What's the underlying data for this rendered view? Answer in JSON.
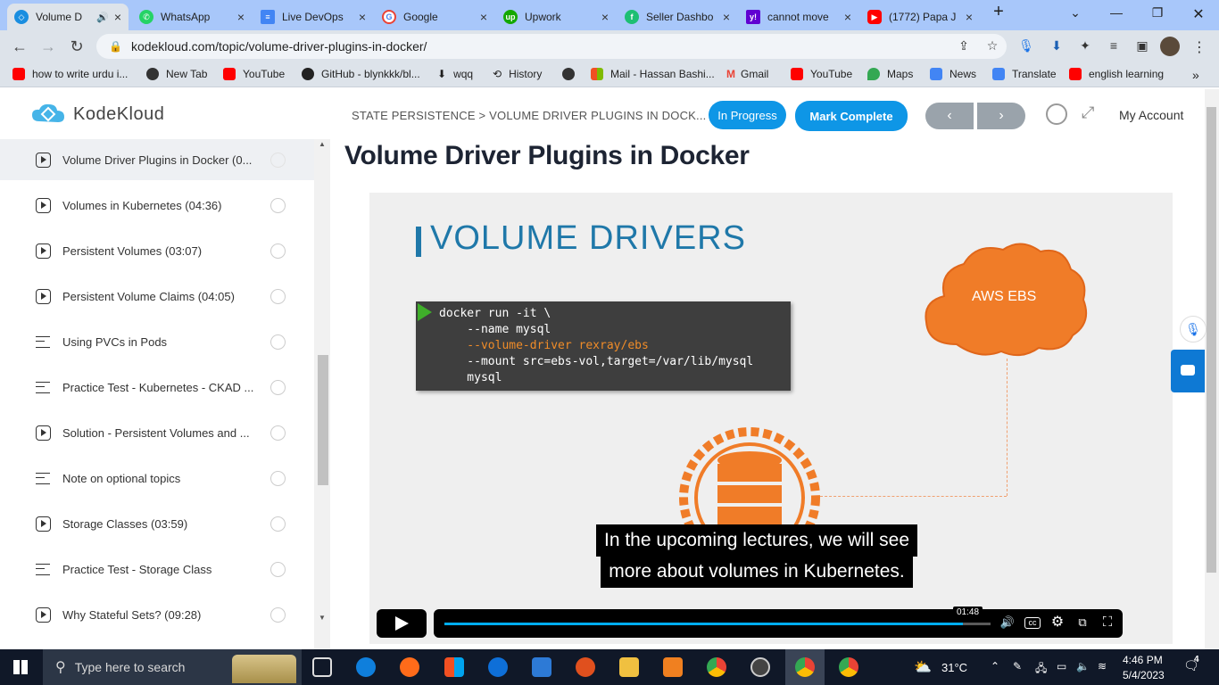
{
  "browser": {
    "tabs": [
      {
        "title": "Volume D",
        "icon": "kodekloud-favicon",
        "color": "#1a8ee0",
        "active": true,
        "audio": true
      },
      {
        "title": "WhatsApp",
        "icon": "whatsapp-favicon",
        "color": "#25d366"
      },
      {
        "title": "Live DevOps",
        "icon": "docs-favicon",
        "color": "#4285f4"
      },
      {
        "title": "Google",
        "icon": "google-favicon",
        "color": "#ea4335"
      },
      {
        "title": "Upwork",
        "icon": "upwork-favicon",
        "color": "#14a800"
      },
      {
        "title": "Seller Dashbo",
        "icon": "seller-favicon",
        "color": "#1dbf73"
      },
      {
        "title": "cannot move",
        "icon": "yahoo-favicon",
        "color": "#6001d2"
      },
      {
        "title": "(1772) Papa J",
        "icon": "youtube-favicon",
        "color": "#ff0000"
      }
    ],
    "url": "kodekloud.com/topic/volume-driver-plugins-in-docker/",
    "bookmarks": [
      {
        "label": "how to write urdu i...",
        "color": "#ff0000"
      },
      {
        "label": "New Tab",
        "color": "#333333"
      },
      {
        "label": "YouTube",
        "color": "#ff0000"
      },
      {
        "label": "GitHub - blynkkk/bl...",
        "color": "#222222"
      },
      {
        "label": "wqq",
        "color": "#333333"
      },
      {
        "label": "History",
        "color": "#333333"
      },
      {
        "label": "",
        "color": "#333333"
      },
      {
        "label": "Mail - Hassan Bashi...",
        "color": "#f25022"
      },
      {
        "label": "Gmail",
        "color": "#ea4335"
      },
      {
        "label": "YouTube",
        "color": "#ff0000"
      },
      {
        "label": "Maps",
        "color": "#34a853"
      },
      {
        "label": "News",
        "color": "#4285f4"
      },
      {
        "label": "Translate",
        "color": "#4285f4"
      },
      {
        "label": "english learning",
        "color": "#ff0000"
      }
    ]
  },
  "header": {
    "logo_text": "KodeKloud",
    "breadcrumb": "STATE PERSISTENCE > VOLUME DRIVER PLUGINS IN DOCK...",
    "status_label": "In Progress",
    "complete_label": "Mark Complete",
    "prev_label": "‹",
    "next_label": "›",
    "account_label": "My Account"
  },
  "sidebar": {
    "lessons": [
      {
        "label": "Volume Driver Plugins in Docker (0...",
        "type": "video",
        "current": true
      },
      {
        "label": "Volumes in Kubernetes (04:36)",
        "type": "video"
      },
      {
        "label": "Persistent Volumes (03:07)",
        "type": "video"
      },
      {
        "label": "Persistent Volume Claims (04:05)",
        "type": "video"
      },
      {
        "label": "Using PVCs in Pods",
        "type": "text"
      },
      {
        "label": "Practice Test - Kubernetes - CKAD ...",
        "type": "text"
      },
      {
        "label": "Solution - Persistent Volumes and ...",
        "type": "video"
      },
      {
        "label": "Note on optional topics",
        "type": "text"
      },
      {
        "label": "Storage Classes (03:59)",
        "type": "video"
      },
      {
        "label": "Practice Test - Storage Class",
        "type": "text"
      },
      {
        "label": "Why Stateful Sets? (09:28)",
        "type": "video"
      }
    ]
  },
  "main": {
    "title": "Volume Driver Plugins in Docker",
    "slide": {
      "heading": "VOLUME DRIVERS",
      "code_lines": [
        {
          "text": "docker run -it \\",
          "color": "#ffffff"
        },
        {
          "text": "    --name mysql",
          "color": "#ffffff"
        },
        {
          "text": "    --volume-driver rexray/ebs",
          "color": "#f08c28"
        },
        {
          "text": "    --mount src=ebs-vol,target=/var/lib/mysql",
          "color": "#ffffff"
        },
        {
          "text": "    mysql",
          "color": "#ffffff"
        }
      ],
      "cloud_label": "AWS EBS"
    },
    "caption": [
      "In the upcoming lectures, we will see",
      "more about volumes in Kubernetes."
    ],
    "player": {
      "time": "01:48",
      "progress": 0.95
    }
  },
  "taskbar": {
    "search_placeholder": "Type here to search",
    "temperature": "31°C",
    "time": "4:46 PM",
    "date": "5/4/2023",
    "notifications": "4"
  }
}
